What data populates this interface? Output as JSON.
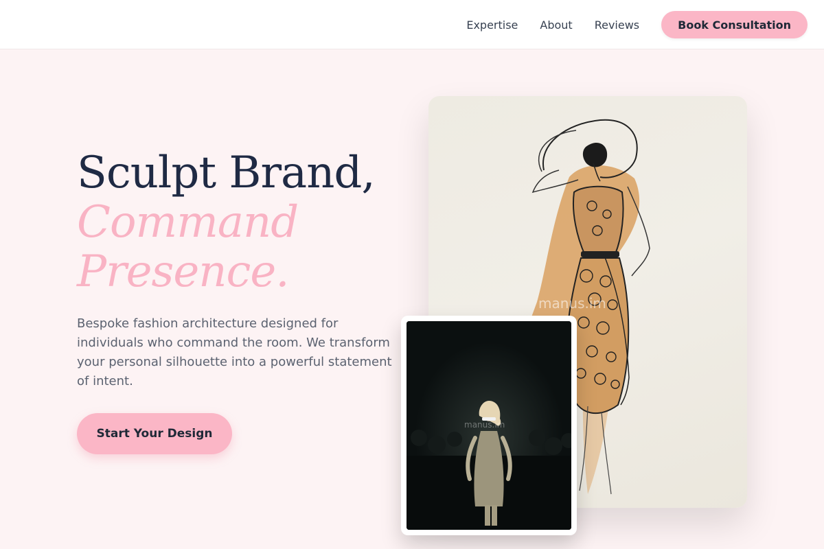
{
  "nav": {
    "links": [
      "Expertise",
      "About",
      "Reviews"
    ],
    "cta_label": "Book Consultation"
  },
  "hero": {
    "title_line1": "Sculpt Brand,",
    "title_line2": "Command",
    "title_line3": "Presence.",
    "description": "Bespoke fashion architecture designed for individuals who command the room. We transform your personal silhouette into a powerful statement of intent.",
    "cta_label": "Start Your Design"
  },
  "images": {
    "sketch_watermark": "manus.im",
    "runway_watermark": "manus.im"
  },
  "colors": {
    "accent_pink": "#fbb6c6",
    "title_navy": "#1f2a44",
    "background": "#fdf3f4"
  }
}
